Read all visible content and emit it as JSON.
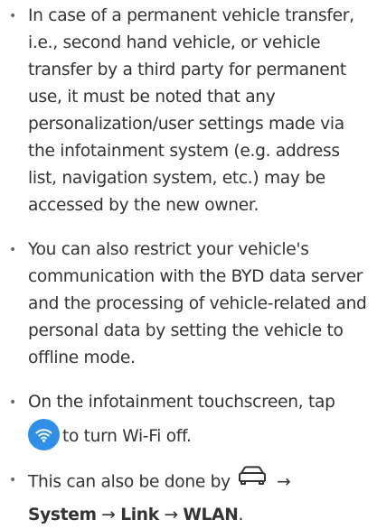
{
  "bullets": [
    {
      "text": "In case of a permanent vehicle transfer, i.e., second hand vehicle, or vehicle transfer by a third party for permanent use, it must be noted that any personalization/user settings made via the infotainment system (e.g. address list, navigation system, etc.) may be accessed by the new owner."
    },
    {
      "text": "You can also restrict your vehicle's communication with the BYD data server and the processing of vehicle-related and personal data by setting the vehicle to offline mode."
    },
    {
      "text_before": "On the infotainment touchscreen, tap",
      "icon": "wifi-icon",
      "text_after": "to turn Wi-Fi off."
    },
    {
      "text_before": "This can also be done by",
      "icon": "car-icon",
      "arrow1": "→",
      "path_1": "System",
      "arrow2": "→",
      "path_2": "Link",
      "arrow3": "→",
      "path_3": "WLAN",
      "end": "."
    }
  ],
  "bullet_glyph": "•",
  "colors": {
    "text": "#333333",
    "wifi_icon_bg": "#2f8fe8",
    "bullet": "#666666"
  }
}
